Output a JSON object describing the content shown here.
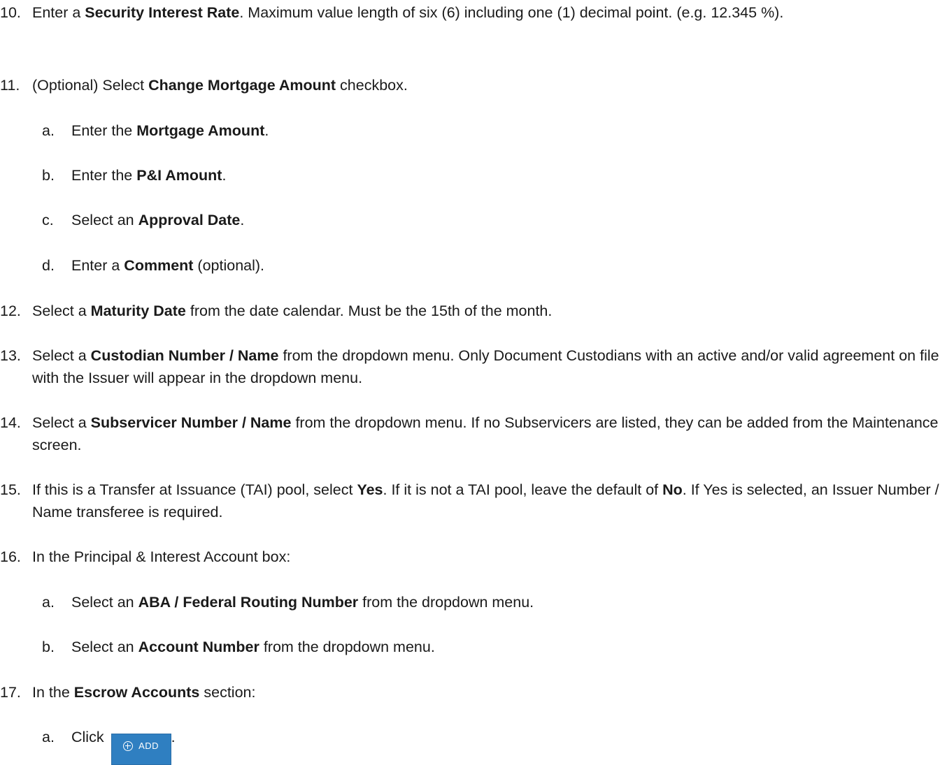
{
  "steps": [
    {
      "number": "10.",
      "parts": [
        "Enter a ",
        "Security Interest Rate",
        ". Maximum value length of six (6) including one (1) decimal point. (e.g. 12.345 %)."
      ]
    },
    {
      "number": "11.",
      "parts": [
        "(Optional) Select ",
        "Change Mortgage Amount",
        " checkbox."
      ],
      "substeps": [
        {
          "letter": "a.",
          "parts": [
            "Enter the ",
            "Mortgage Amount",
            "."
          ]
        },
        {
          "letter": "b.",
          "parts": [
            "Enter the ",
            "P&I Amount",
            "."
          ]
        },
        {
          "letter": "c.",
          "parts": [
            "Select an ",
            "Approval Date",
            "."
          ]
        },
        {
          "letter": "d.",
          "parts": [
            "Enter a ",
            "Comment",
            " (optional)."
          ]
        }
      ]
    },
    {
      "number": "12.",
      "parts": [
        "Select a ",
        "Maturity Date",
        " from the date calendar. Must be the 15th of the month."
      ]
    },
    {
      "number": "13.",
      "parts": [
        "Select a ",
        "Custodian Number / Name",
        " from the dropdown menu. Only Document Custodians with an active and/or valid agreement on file with the Issuer will appear in the dropdown menu."
      ]
    },
    {
      "number": "14.",
      "parts": [
        "Select a ",
        "Subservicer Number / Name",
        " from the dropdown menu. If no Subservicers are listed, they can be added from the Maintenance screen."
      ]
    },
    {
      "number": "15.",
      "parts": [
        "If this is a Transfer at Issuance (TAI) pool, select ",
        "Yes",
        ". If it is not a TAI pool, leave the default of ",
        "No",
        ". If Yes is selected, an Issuer Number / Name transferee is required."
      ]
    },
    {
      "number": "16.",
      "parts": [
        "In the Principal & Interest Account box:"
      ],
      "substeps": [
        {
          "letter": "a.",
          "parts": [
            "Select an ",
            "ABA / Federal Routing Number",
            " from the dropdown menu."
          ]
        },
        {
          "letter": "b.",
          "parts": [
            "Select an ",
            "Account Number",
            " from the dropdown menu."
          ]
        }
      ]
    },
    {
      "number": "17.",
      "parts": [
        "In the ",
        "Escrow Accounts",
        " section:"
      ],
      "substeps": [
        {
          "letter": "a.",
          "parts": [
            "Click ",
            "."
          ],
          "button_label": "ADD",
          "button_icon": "plus-circle-icon"
        }
      ]
    }
  ],
  "colors": {
    "text": "#1a1a1a",
    "button_bg": "#2f7fc1",
    "button_text": "#ffffff"
  }
}
